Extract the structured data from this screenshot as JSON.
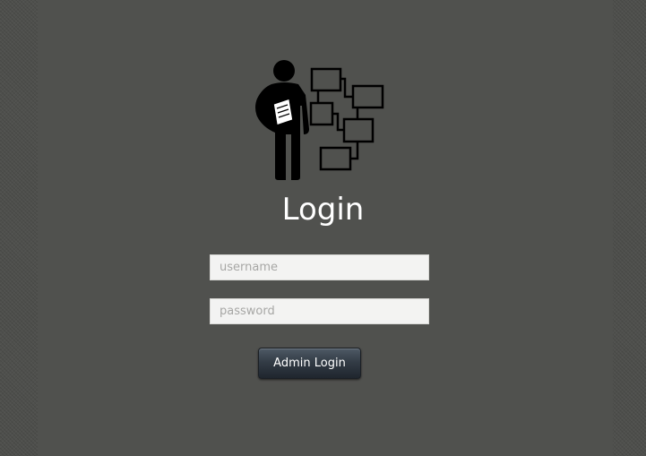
{
  "login": {
    "title": "Login",
    "logo_icon": "teacher-org-chart-icon",
    "username": {
      "value": "",
      "placeholder": "username"
    },
    "password": {
      "value": "",
      "placeholder": "password"
    },
    "submit_label": "Admin Login"
  },
  "colors": {
    "background": "#50514e",
    "title_text": "#ffffff",
    "field_background": "#f3f3f2",
    "button_gradient_top": "#4f5a66",
    "button_gradient_bottom": "#1f262e"
  }
}
